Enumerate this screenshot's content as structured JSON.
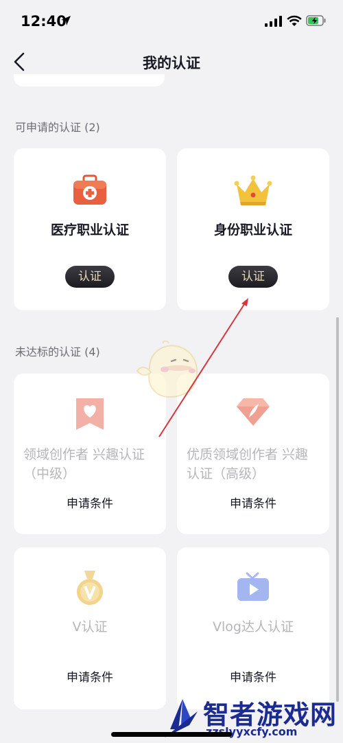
{
  "status": {
    "time": "12:40"
  },
  "header": {
    "title": "我的认证"
  },
  "sections": {
    "available": {
      "title": "可申请的认证 (2)"
    },
    "unmet": {
      "title": "未达标的认证 (4)"
    }
  },
  "cards": {
    "medical": {
      "name": "医疗职业认证",
      "button": "认证",
      "icon": "medical-kit-icon"
    },
    "identity": {
      "name": "身份职业认证",
      "button": "认证",
      "icon": "crown-icon"
    },
    "creator_mid": {
      "name": "领域创作者 兴趣认证（中级）",
      "link": "申请条件",
      "icon": "heart-ribbon-icon"
    },
    "creator_high": {
      "name": "优质领域创作者 兴趣认证（高级）",
      "link": "申请条件",
      "icon": "feather-diamond-icon"
    },
    "v": {
      "name": "V认证",
      "link": "申请条件",
      "icon": "v-medal-icon"
    },
    "vlog": {
      "name": "Vlog达人认证",
      "link": "申请条件",
      "icon": "tv-play-icon"
    }
  },
  "watermark": {
    "text": "智者游戏网",
    "url": "zzslyyxcfy.com"
  },
  "colors": {
    "button_bg": "#26262c",
    "button_text": "#e9d7b8",
    "background": "#f2f2f4",
    "arrow": "#d9363e"
  }
}
